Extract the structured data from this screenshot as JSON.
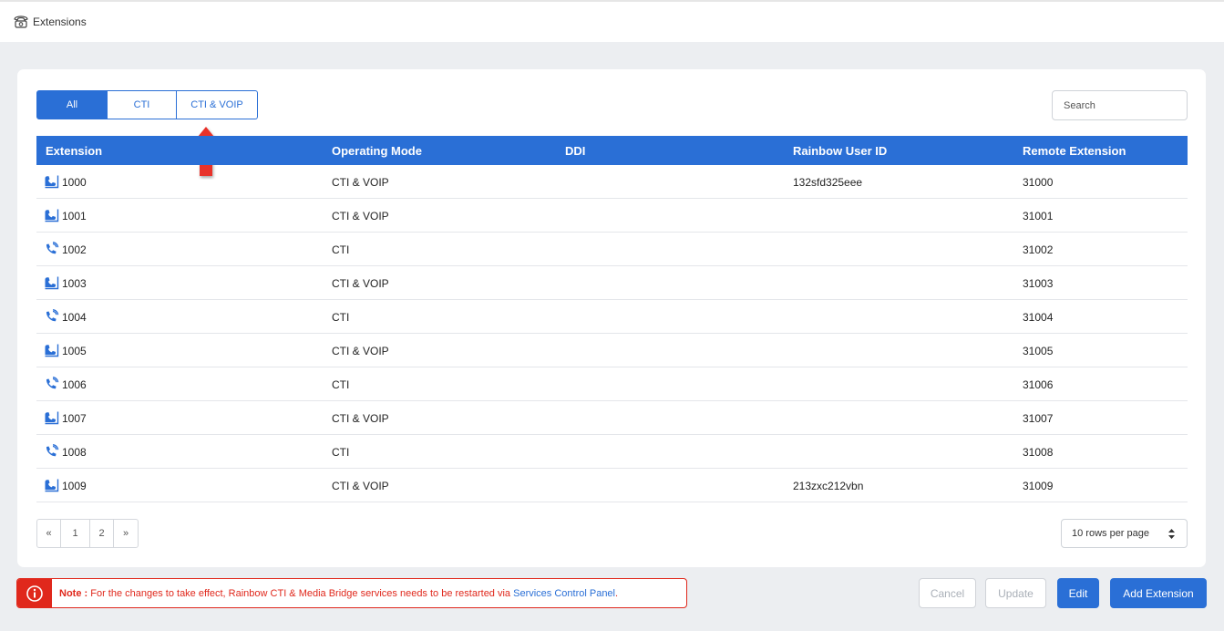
{
  "header": {
    "title": "Extensions",
    "icon": "phone-icon"
  },
  "filters": {
    "all": "All",
    "cti": "CTI",
    "cti_voip": "CTI & VOIP",
    "active": "All"
  },
  "search": {
    "placeholder": "Search"
  },
  "table": {
    "columns": {
      "extension": "Extension",
      "operating_mode": "Operating Mode",
      "ddi": "DDI",
      "rainbow_user_id": "Rainbow User ID",
      "remote_extension": "Remote Extension"
    },
    "rows": [
      {
        "icon": "desk-phone-icon",
        "extension": "1000",
        "mode": "CTI & VOIP",
        "ddi": "",
        "rainbow_id": "132sfd325eee",
        "remote": "31000"
      },
      {
        "icon": "desk-phone-icon",
        "extension": "1001",
        "mode": "CTI & VOIP",
        "ddi": "",
        "rainbow_id": "",
        "remote": "31001"
      },
      {
        "icon": "ringing-phone-icon",
        "extension": "1002",
        "mode": "CTI",
        "ddi": "",
        "rainbow_id": "",
        "remote": "31002"
      },
      {
        "icon": "desk-phone-icon",
        "extension": "1003",
        "mode": "CTI & VOIP",
        "ddi": "",
        "rainbow_id": "",
        "remote": "31003"
      },
      {
        "icon": "ringing-phone-icon",
        "extension": "1004",
        "mode": "CTI",
        "ddi": "",
        "rainbow_id": "",
        "remote": "31004"
      },
      {
        "icon": "desk-phone-icon",
        "extension": "1005",
        "mode": "CTI & VOIP",
        "ddi": "",
        "rainbow_id": "",
        "remote": "31005"
      },
      {
        "icon": "ringing-phone-icon",
        "extension": "1006",
        "mode": "CTI",
        "ddi": "",
        "rainbow_id": "",
        "remote": "31006"
      },
      {
        "icon": "desk-phone-icon",
        "extension": "1007",
        "mode": "CTI & VOIP",
        "ddi": "",
        "rainbow_id": "",
        "remote": "31007"
      },
      {
        "icon": "ringing-phone-icon",
        "extension": "1008",
        "mode": "CTI",
        "ddi": "",
        "rainbow_id": "",
        "remote": "31008"
      },
      {
        "icon": "desk-phone-icon",
        "extension": "1009",
        "mode": "CTI & VOIP",
        "ddi": "",
        "rainbow_id": "213zxc212vbn",
        "remote": "31009"
      }
    ]
  },
  "pagination": {
    "prev": "«",
    "pages": [
      "1",
      "2"
    ],
    "next": "»"
  },
  "rows_per_page": {
    "label": "10 rows per page"
  },
  "note": {
    "label": "Note :",
    "text": " For the changes to take effect, Rainbow CTI & Media Bridge services needs to be restarted via ",
    "link": "Services Control Panel",
    "suffix": "."
  },
  "actions": {
    "cancel": "Cancel",
    "update": "Update",
    "edit": "Edit",
    "add": "Add Extension"
  },
  "colors": {
    "accent": "#2a6fd6",
    "danger": "#e0281c",
    "background": "#eceef1"
  }
}
